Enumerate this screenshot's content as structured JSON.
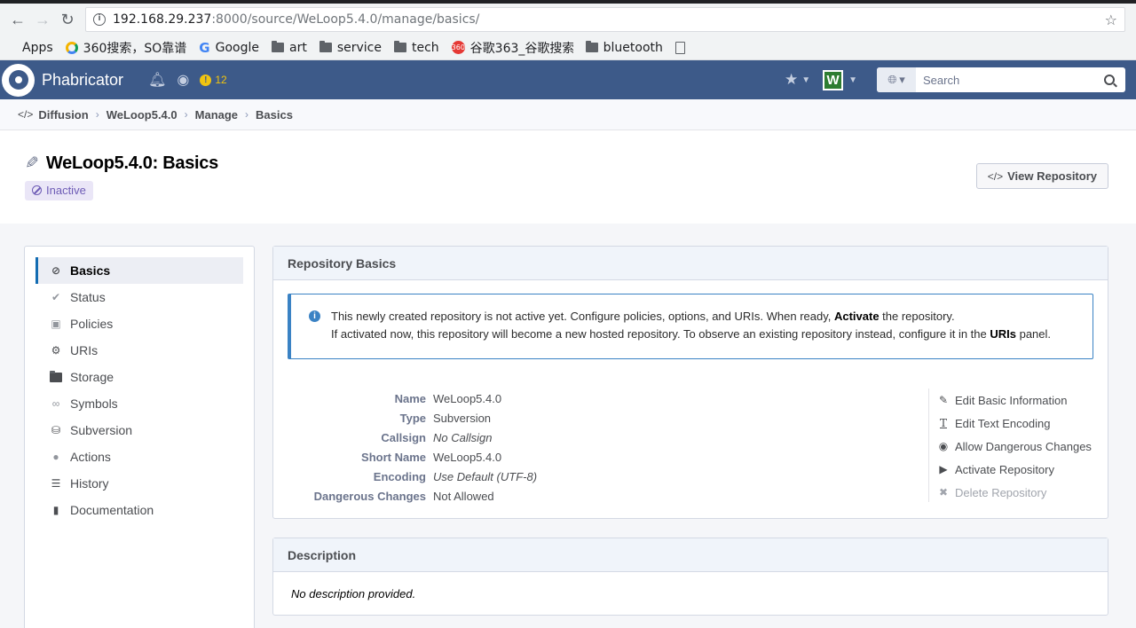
{
  "browser": {
    "url_host": "192.168.29.237",
    "url_rest": ":8000/source/WeLoop5.4.0/manage/basics/",
    "bookmarks": [
      "Apps",
      "360搜索，SO靠谱",
      "Google",
      "art",
      "service",
      "tech",
      "谷歌363_谷歌搜索",
      "bluetooth"
    ]
  },
  "header": {
    "app_name": "Phabricator",
    "alert_count": "12",
    "search_placeholder": "Search"
  },
  "crumbs": [
    "Diffusion",
    "WeLoop5.4.0",
    "Manage",
    "Basics"
  ],
  "page": {
    "title": "WeLoop5.4.0: Basics",
    "status": "Inactive",
    "view_button": "View Repository"
  },
  "sidenav": {
    "items": [
      {
        "label": "Basics",
        "icon": "ban-icon"
      },
      {
        "label": "Status",
        "icon": "check-icon"
      },
      {
        "label": "Policies",
        "icon": "lock-icon"
      },
      {
        "label": "URIs",
        "icon": "cogs-icon"
      },
      {
        "label": "Storage",
        "icon": "folder-icon"
      },
      {
        "label": "Symbols",
        "icon": "link-icon"
      },
      {
        "label": "Subversion",
        "icon": "database-icon"
      },
      {
        "label": "Actions",
        "icon": "comment-icon"
      },
      {
        "label": "History",
        "icon": "list-icon"
      },
      {
        "label": "Documentation",
        "icon": "book-icon"
      }
    ]
  },
  "basics": {
    "heading": "Repository Basics",
    "notice_line1_a": "This newly created repository is not active yet. Configure policies, options, and URIs. When ready, ",
    "notice_line1_b": "Activate",
    "notice_line1_c": " the repository.",
    "notice_line2_a": "If activated now, this repository will become a new hosted repository. To observe an existing repository instead, configure it in the ",
    "notice_line2_b": "URIs",
    "notice_line2_c": " panel.",
    "properties": [
      {
        "key": "Name",
        "value": "WeLoop5.4.0"
      },
      {
        "key": "Type",
        "value": "Subversion"
      },
      {
        "key": "Callsign",
        "value": "No Callsign"
      },
      {
        "key": "Short Name",
        "value": "WeLoop5.4.0"
      },
      {
        "key": "Encoding",
        "value": "Use Default (UTF-8)"
      },
      {
        "key": "Dangerous Changes",
        "value": "Not Allowed"
      }
    ],
    "actions": [
      "Edit Basic Information",
      "Edit Text Encoding",
      "Allow Dangerous Changes",
      "Activate Repository",
      "Delete Repository"
    ]
  },
  "description": {
    "heading": "Description",
    "text": "No description provided."
  },
  "colors": {
    "header_bg": "#3d5a89",
    "accent": "#136cb2",
    "inactive_tag": "#6e5cb6"
  }
}
